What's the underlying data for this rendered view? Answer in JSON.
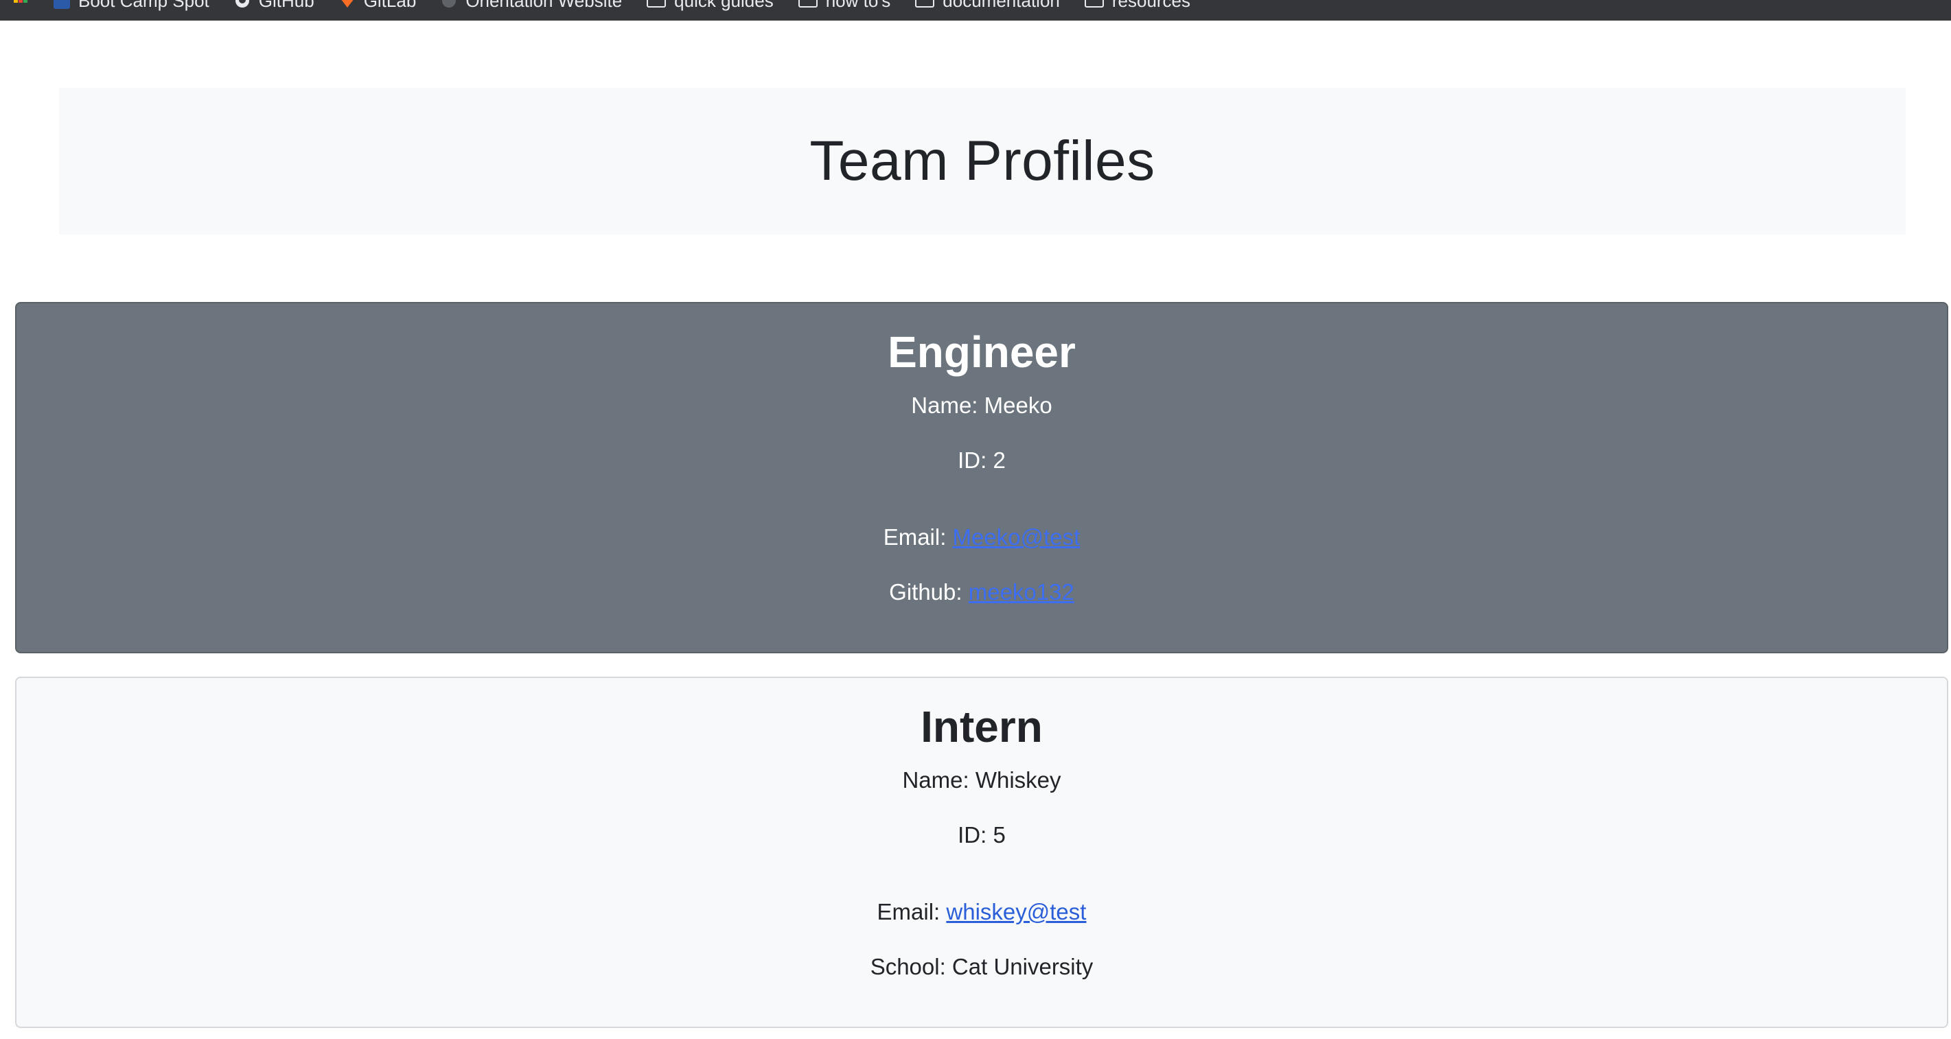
{
  "bookmarks": [
    {
      "label": "Boot Camp Spot",
      "icon": "bootcamp-icon"
    },
    {
      "label": "GitHub",
      "icon": "github-icon"
    },
    {
      "label": "GitLab",
      "icon": "gitlab-icon"
    },
    {
      "label": "Orientation Website",
      "icon": "globe-icon"
    },
    {
      "label": "quick guides",
      "icon": "folder-icon"
    },
    {
      "label": "how to's",
      "icon": "folder-icon"
    },
    {
      "label": "documentation",
      "icon": "folder-icon"
    },
    {
      "label": "resources",
      "icon": "folder-icon"
    }
  ],
  "header": {
    "title": "Team Profiles"
  },
  "cards": [
    {
      "role": "Engineer",
      "name_label": "Name: Meeko",
      "id_label": "ID: 2",
      "email_prefix": "Email: ",
      "email": "Meeko@test",
      "extra_prefix": "Github: ",
      "extra_link": "meeko132"
    },
    {
      "role": "Intern",
      "name_label": "Name: Whiskey",
      "id_label": "ID: 5",
      "email_prefix": "Email: ",
      "email": "whiskey@test",
      "school_label": "School: Cat University"
    }
  ],
  "colors": {
    "engineer_card": "#6c757d",
    "intern_card": "#f8f9fa",
    "link": "#3d6ef2"
  }
}
